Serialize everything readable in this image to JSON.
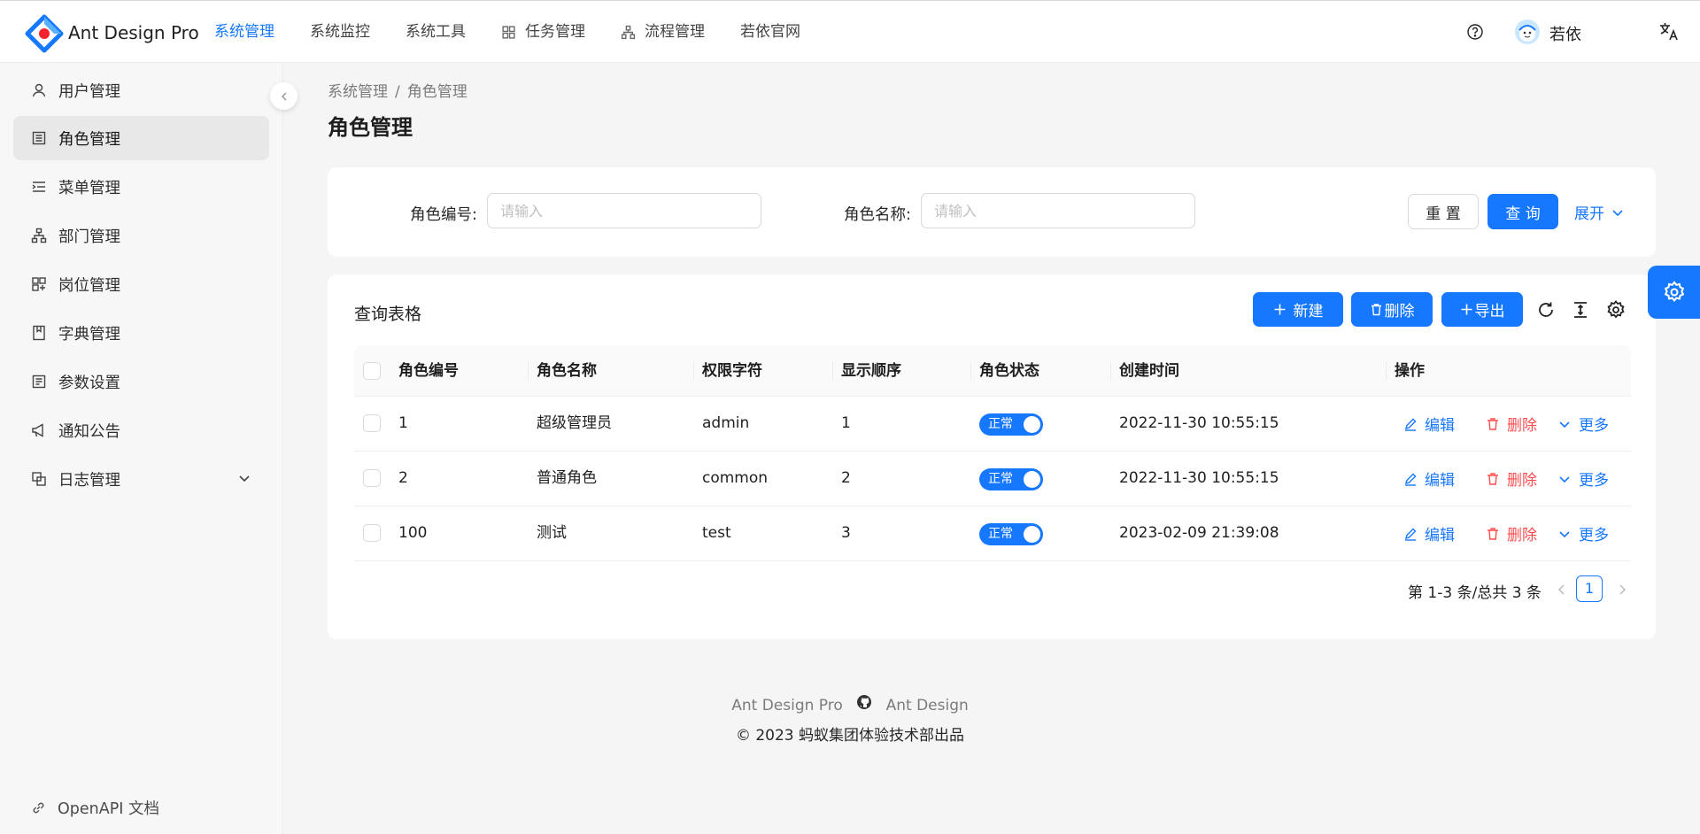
{
  "header": {
    "brand": "Ant Design Pro",
    "nav": [
      {
        "label": "系统管理",
        "active": true,
        "icon": ""
      },
      {
        "label": "系统监控",
        "active": false,
        "icon": ""
      },
      {
        "label": "系统工具",
        "active": false,
        "icon": ""
      },
      {
        "label": "任务管理",
        "active": false,
        "icon": "appstore-icon"
      },
      {
        "label": "流程管理",
        "active": false,
        "icon": "apartment-icon"
      },
      {
        "label": "若依官网",
        "active": false,
        "icon": ""
      }
    ],
    "user_name": "若依",
    "accent_color": "#1677ff"
  },
  "sidebar": {
    "items": [
      {
        "label": "用户管理",
        "icon": "user-icon"
      },
      {
        "label": "角色管理",
        "icon": "role-icon",
        "active": true
      },
      {
        "label": "菜单管理",
        "icon": "menu-icon"
      },
      {
        "label": "部门管理",
        "icon": "cluster-icon"
      },
      {
        "label": "岗位管理",
        "icon": "post-icon"
      },
      {
        "label": "字典管理",
        "icon": "book-icon"
      },
      {
        "label": "参数设置",
        "icon": "setting-list-icon"
      },
      {
        "label": "通知公告",
        "icon": "notification-icon"
      },
      {
        "label": "日志管理",
        "icon": "log-icon",
        "expandable": true
      }
    ],
    "bottom_link": "OpenAPI 文档"
  },
  "breadcrumb": {
    "items": [
      "系统管理",
      "角色管理"
    ],
    "separator": "/"
  },
  "page_title": "角色管理",
  "search": {
    "fields": [
      {
        "label": "角色编号:",
        "placeholder": "请输入",
        "value": ""
      },
      {
        "label": "角色名称:",
        "placeholder": "请输入",
        "value": ""
      }
    ],
    "reset_label": "重 置",
    "query_label": "查 询",
    "expand_label": "展开"
  },
  "table": {
    "title": "查询表格",
    "toolbar": {
      "new_label": "新建",
      "delete_label": "删除",
      "export_label": "导出"
    },
    "columns": [
      "角色编号",
      "角色名称",
      "权限字符",
      "显示顺序",
      "角色状态",
      "创建时间",
      "操作"
    ],
    "rows": [
      {
        "id": "1",
        "name": "超级管理员",
        "key": "admin",
        "sort": "1",
        "status": "正常",
        "created": "2022-11-30 10:55:15"
      },
      {
        "id": "2",
        "name": "普通角色",
        "key": "common",
        "sort": "2",
        "status": "正常",
        "created": "2022-11-30 10:55:15"
      },
      {
        "id": "100",
        "name": "测试",
        "key": "test",
        "sort": "3",
        "status": "正常",
        "created": "2023-02-09 21:39:08"
      }
    ],
    "actions": {
      "edit": "编辑",
      "delete": "删除",
      "more": "更多"
    },
    "pagination": {
      "summary": "第 1-3 条/总共 3 条",
      "current_page": "1"
    }
  },
  "footer": {
    "links": [
      "Ant Design Pro",
      "Ant Design"
    ],
    "copyright": "2023 蚂蚁集团体验技术部出品"
  }
}
